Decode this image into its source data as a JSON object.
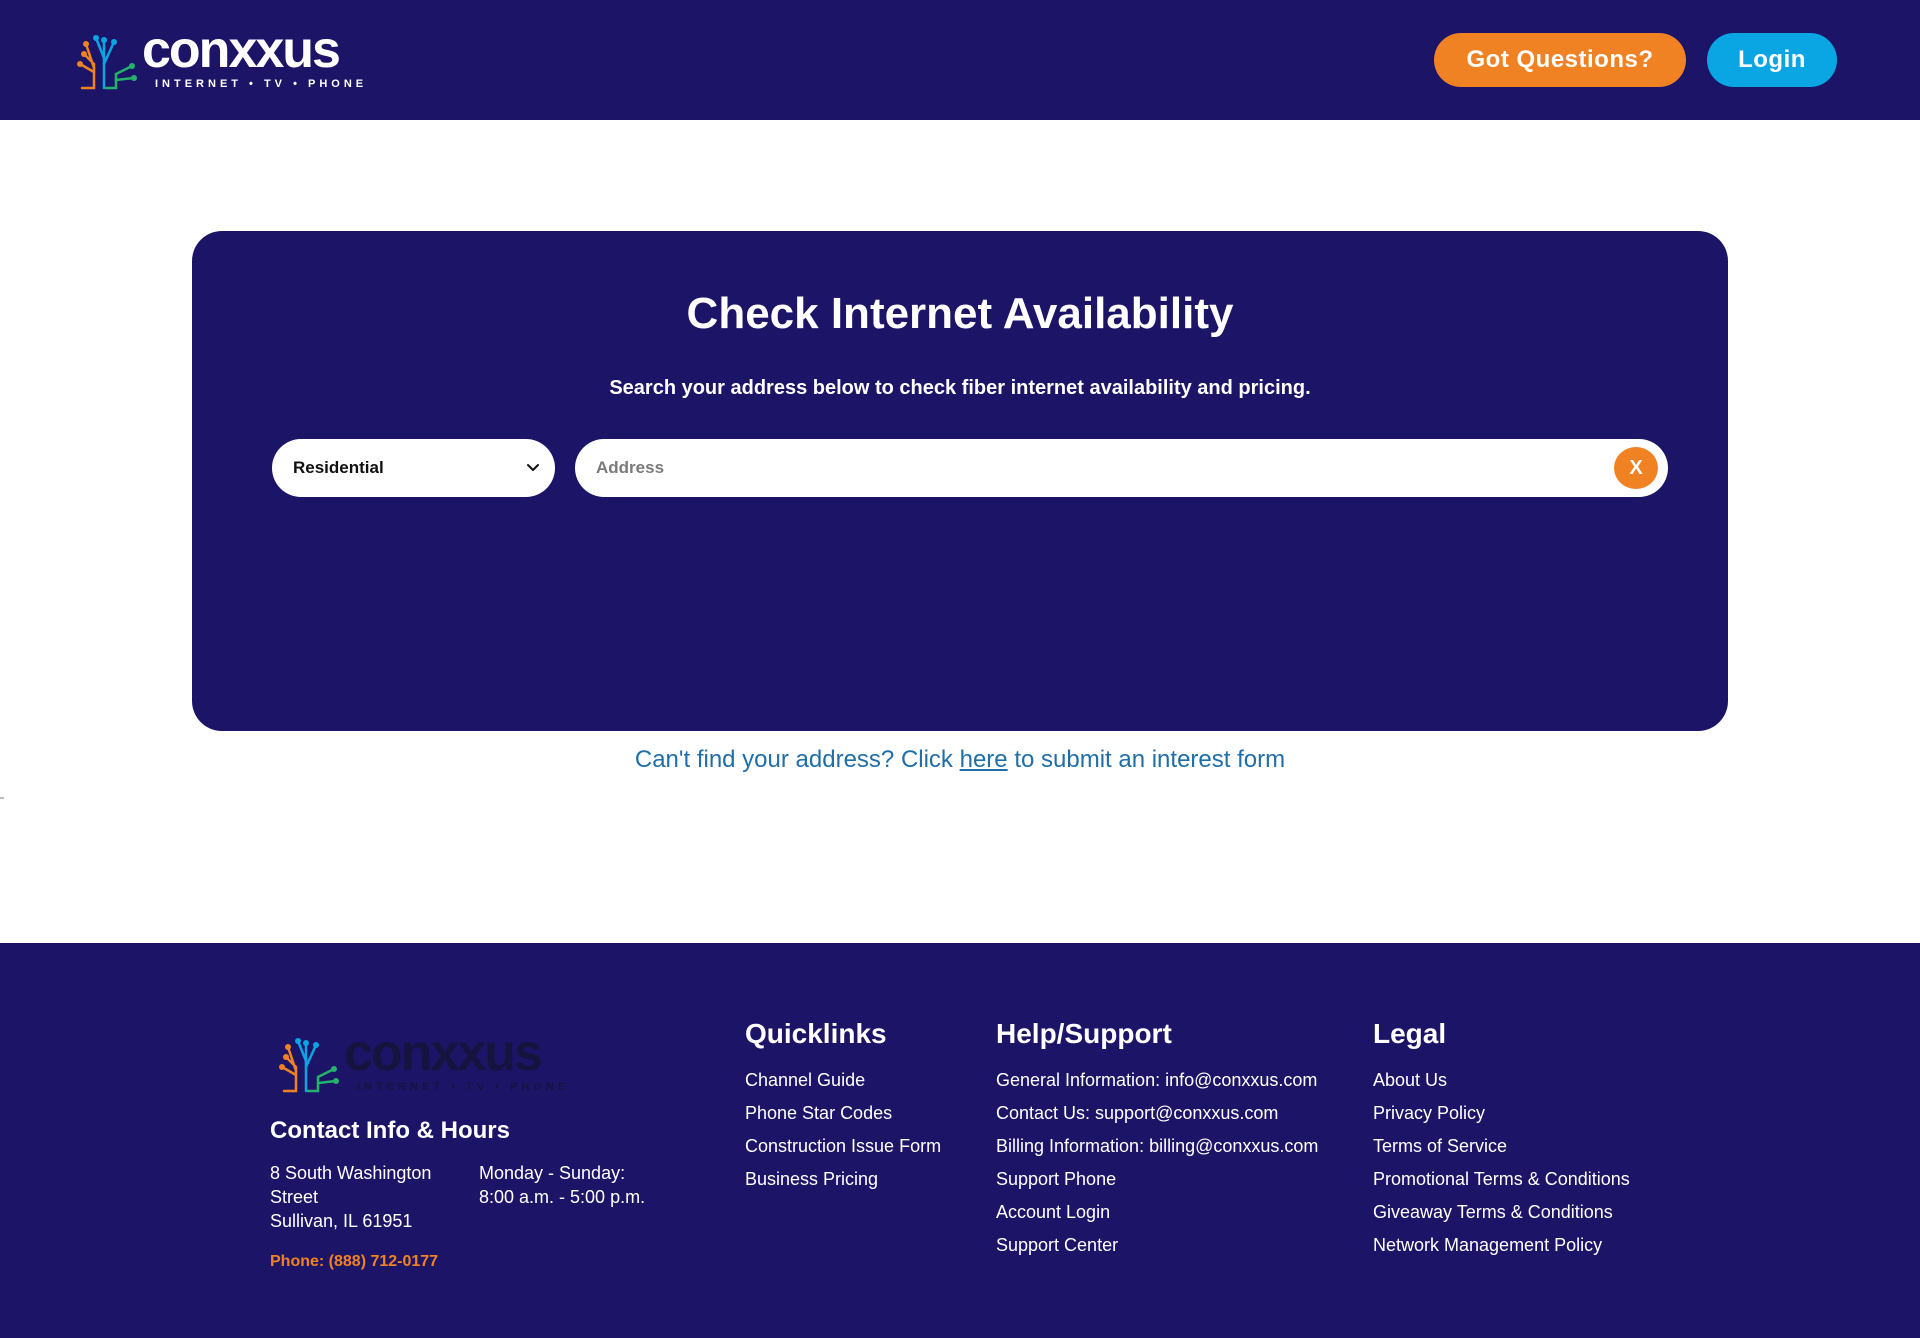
{
  "header": {
    "logo_text": "conxxus",
    "logo_tagline": "INTERNET • TV • PHONE",
    "questions_label": "Got Questions?",
    "login_label": "Login"
  },
  "availability": {
    "title": "Check Internet Availability",
    "subtitle": "Search your address below to check fiber internet availability and pricing.",
    "select_value": "Residential",
    "address_placeholder": "Address",
    "address_value": "",
    "clear_label": "X"
  },
  "interest": {
    "prefix": "Can't find your address? Click ",
    "link_label": "here",
    "suffix": " to submit an interest form"
  },
  "footer": {
    "logo_text": "conxxus",
    "logo_tagline": "INTERNET • TV • PHONE",
    "contact_title": "Contact Info & Hours",
    "address_line1": "8 South Washington Street",
    "address_line2": "Sullivan, IL 61951",
    "hours_line1": "Monday - Sunday:",
    "hours_line2": "8:00 a.m. - 5:00 p.m.",
    "phone": "Phone: (888) 712-0177",
    "quicklinks": {
      "title": "Quicklinks",
      "items": [
        "Channel Guide",
        "Phone Star Codes",
        "Construction Issue Form",
        "Business Pricing"
      ]
    },
    "help": {
      "title": "Help/Support",
      "items": [
        "General Information: info@conxxus.com",
        "Contact Us: support@conxxus.com",
        "Billing Information: billing@conxxus.com",
        "Support Phone",
        "Account Login",
        "Support Center"
      ]
    },
    "legal": {
      "title": "Legal",
      "items": [
        "About Us",
        "Privacy Policy",
        "Terms of Service",
        "Promotional Terms & Conditions",
        "Giveaway Terms & Conditions",
        "Network Management Policy"
      ]
    }
  },
  "colors": {
    "navy": "#1c1567",
    "orange": "#f08223",
    "blue": "#0aa5e3",
    "link_blue": "#1f6ea8"
  }
}
